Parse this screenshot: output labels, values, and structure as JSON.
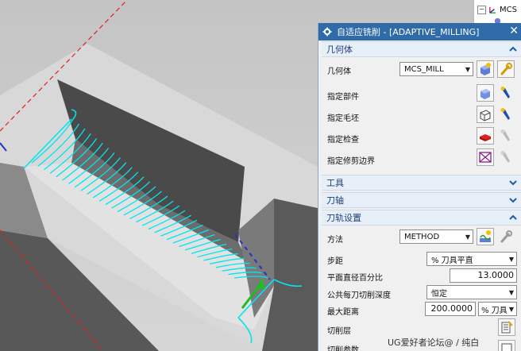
{
  "navigator": {
    "items": [
      {
        "label": "MCS",
        "icon": "mcs-icon"
      }
    ]
  },
  "dialog": {
    "title": "自适应铣削 - [ADAPTIVE_MILLING]",
    "close_label": "✕",
    "geometry": {
      "header": "几何体",
      "geometry_label": "几何体",
      "geometry_value": "MCS_MILL",
      "specify_part": "指定部件",
      "specify_blank": "指定毛坯",
      "specify_check": "指定检查",
      "specify_trim_boundary": "指定修剪边界"
    },
    "tool": {
      "header": "工具"
    },
    "axis": {
      "header": "刀轴"
    },
    "path_settings": {
      "header": "刀轨设置",
      "method_label": "方法",
      "method_value": "METHOD",
      "stepover_label": "步距",
      "stepover_value": "% 刀具平直",
      "percent_flat_label": "平面直径百分比",
      "percent_flat_value": "13.0000",
      "common_depth_label": "公共每刀切削深度",
      "common_depth_value": "恒定",
      "max_distance_label": "最大距离",
      "max_distance_value": "200.0000",
      "max_distance_unit": "% 刀具",
      "cut_levels_label": "切削层",
      "cut_params_label": "切削参数"
    }
  },
  "watermark": "UG爱好者论坛@ / 纯白",
  "colors": {
    "titlebar": "#2f6aa9",
    "section_text": "#1f3f7a",
    "toolpath": "#00e5ee",
    "red_dash": "#e02020"
  }
}
